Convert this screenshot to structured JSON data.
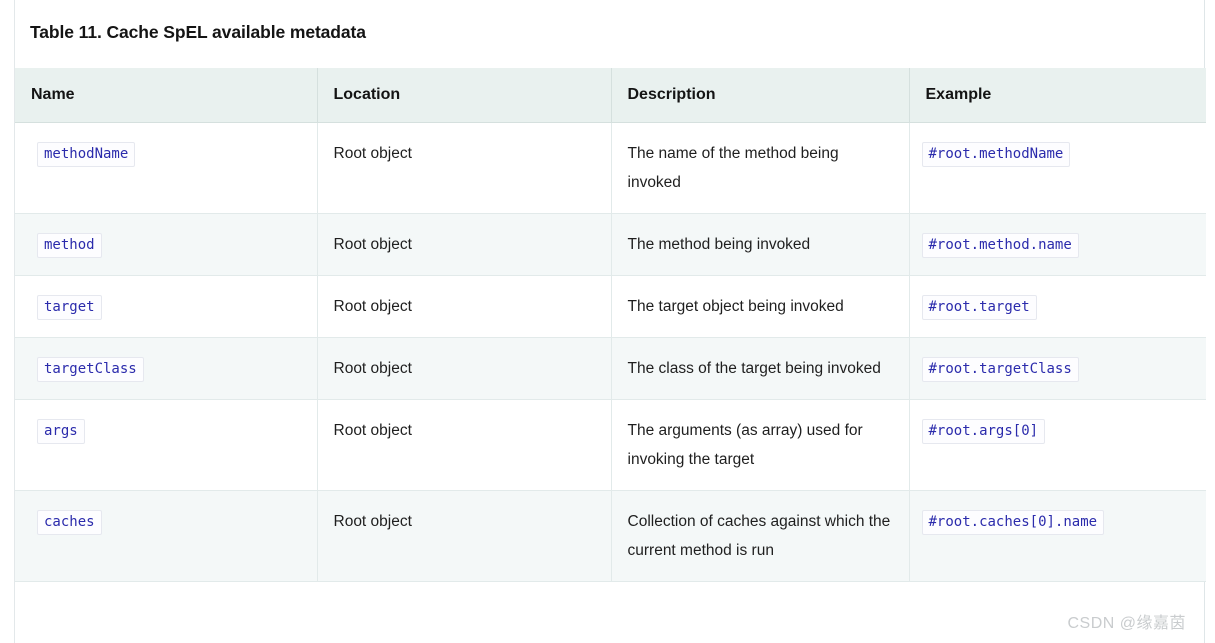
{
  "document": {
    "caption": "Table 11. Cache SpEL available metadata",
    "watermark": "CSDN @缘嘉茵"
  },
  "table": {
    "columns": [
      {
        "key": "name",
        "label": "Name"
      },
      {
        "key": "location",
        "label": "Location"
      },
      {
        "key": "description",
        "label": "Description"
      },
      {
        "key": "example",
        "label": "Example"
      }
    ],
    "rows": [
      {
        "name": "methodName",
        "location": "Root object",
        "description": "The name of the method being invoked",
        "example": "#root.methodName"
      },
      {
        "name": "method",
        "location": "Root object",
        "description": "The method being invoked",
        "example": "#root.method.name"
      },
      {
        "name": "target",
        "location": "Root object",
        "description": "The target object being invoked",
        "example": "#root.target"
      },
      {
        "name": "targetClass",
        "location": "Root object",
        "description": "The class of the target being invoked",
        "example": "#root.targetClass"
      },
      {
        "name": "args",
        "location": "Root object",
        "description": "The arguments (as array) used for invoking the target",
        "example": "#root.args[0]"
      },
      {
        "name": "caches",
        "location": "Root object",
        "description": "Collection of caches against which the current method is run",
        "example": "#root.caches[0].name"
      }
    ]
  },
  "colors": {
    "header_background": "#e9f1ef",
    "stripe_background": "#f4f8f8",
    "code_text": "#2b2bac",
    "border": "#e2eaea"
  }
}
